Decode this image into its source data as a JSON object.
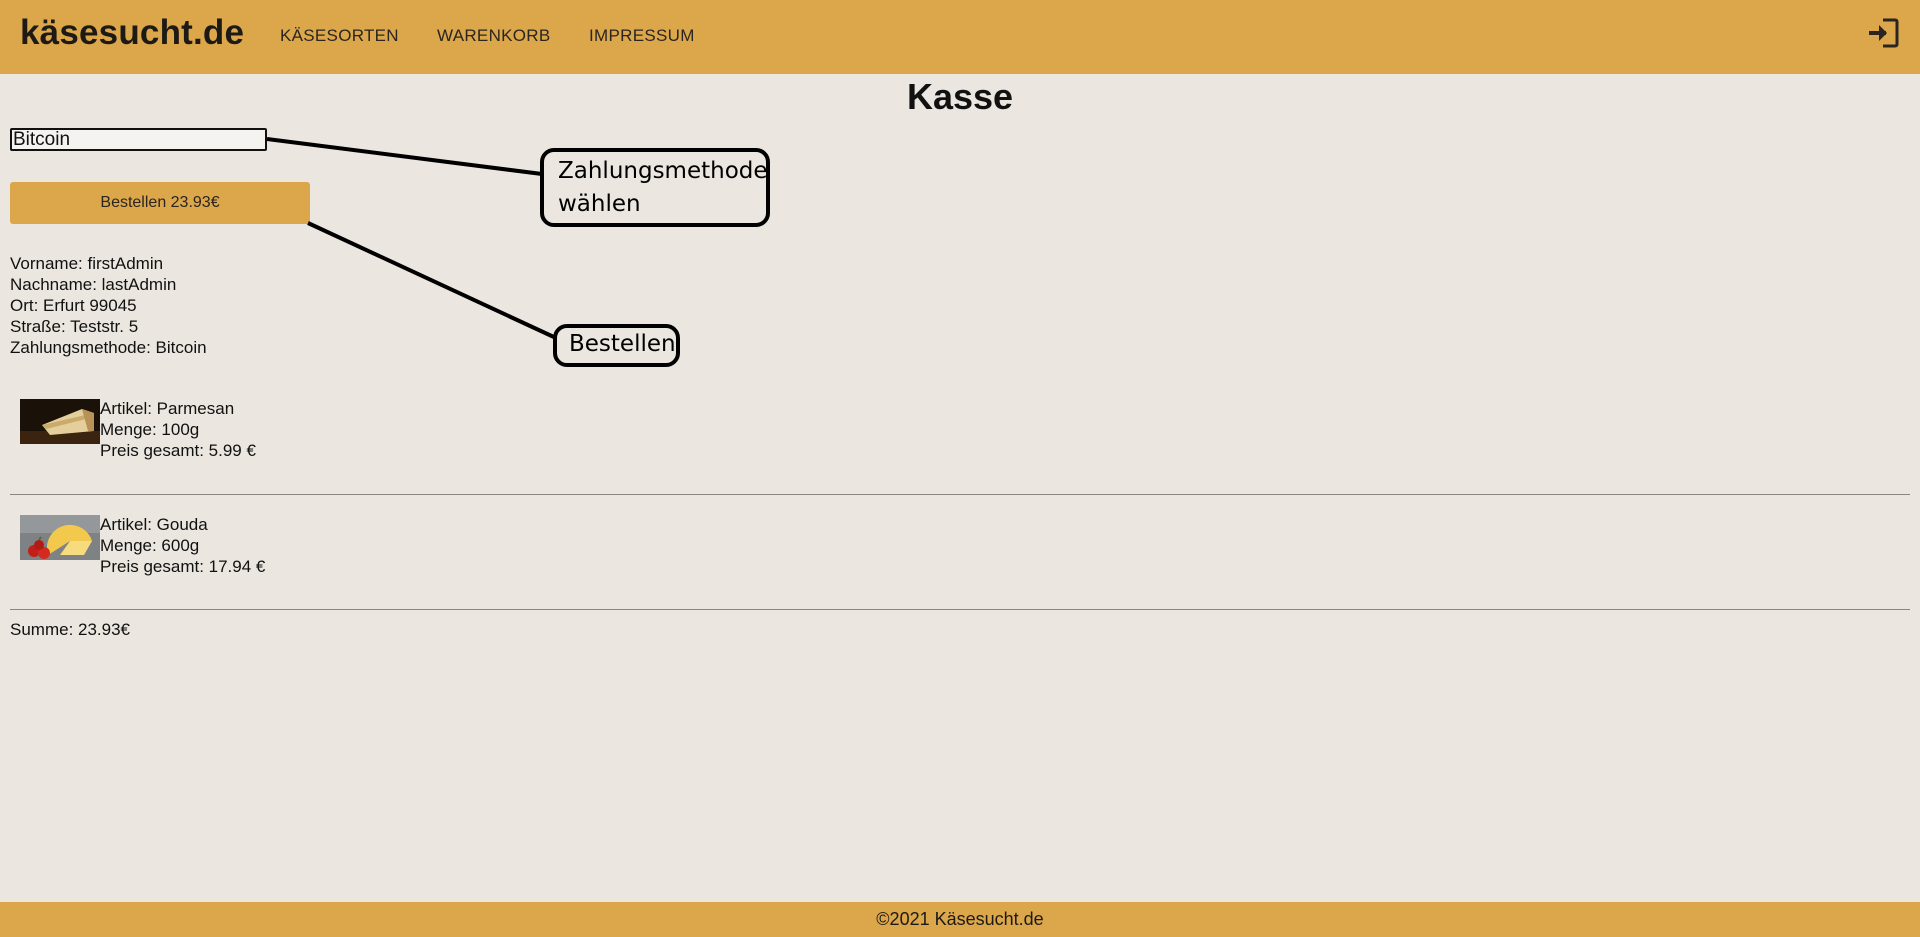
{
  "header": {
    "brand": "käsesucht.de",
    "nav": [
      {
        "label": "KÄSESORTEN"
      },
      {
        "label": "WARENKORB"
      },
      {
        "label": "IMPRESSUM"
      }
    ],
    "login_icon": "login-icon"
  },
  "page": {
    "title": "Kasse"
  },
  "checkout": {
    "payment_method_value": "Bitcoin",
    "order_button_label": "Bestellen 23.93€"
  },
  "customer": {
    "lines": [
      "Vorname: firstAdmin",
      "Nachname: lastAdmin",
      "Ort: Erfurt 99045",
      "Straße: Teststr. 5",
      "Zahlungsmethode: Bitcoin"
    ]
  },
  "cart": {
    "items": [
      {
        "image_icon": "parmesan-image",
        "article": "Artikel: Parmesan",
        "quantity": "Menge: 100g",
        "price": "Preis gesamt: 5.99 €"
      },
      {
        "image_icon": "gouda-image",
        "article": "Artikel: Gouda",
        "quantity": "Menge: 600g",
        "price": "Preis gesamt: 17.94 €"
      }
    ],
    "sum": "Summe: 23.93€"
  },
  "footer": {
    "text": "©2021 Käsesucht.de"
  },
  "annotations": {
    "payment_callout": "Zahlungsmethode wählen",
    "order_callout": "Bestellen"
  },
  "colors": {
    "accent": "#dca64a",
    "background": "#ebe6df",
    "text": "#111111"
  }
}
